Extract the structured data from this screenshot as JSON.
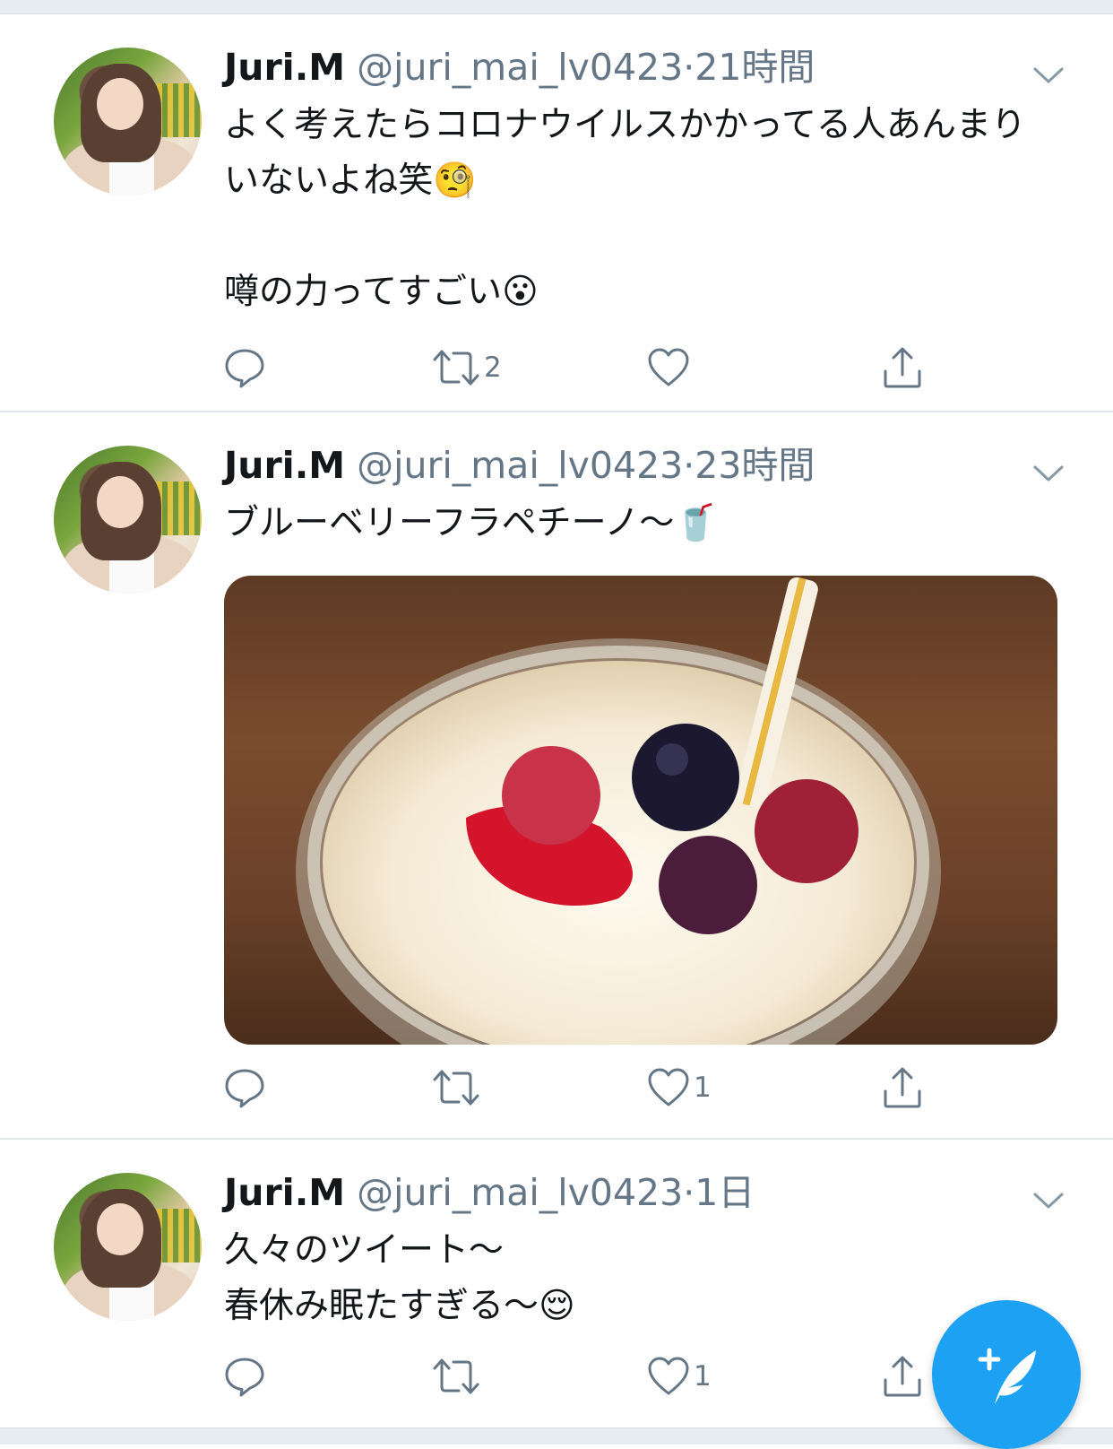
{
  "tweets": [
    {
      "name": "Juri.M",
      "handle": "@juri_mai_lv0423",
      "separator": "·",
      "time": "21時間",
      "text": "よく考えたらコロナウイルスかかってる人あんまりいないよね笑🧐\n\n噂の力ってすごい😮",
      "reply_count": "",
      "retweet_count": "2",
      "like_count": ""
    },
    {
      "name": "Juri.M",
      "handle": "@juri_mai_lv0423",
      "separator": "·",
      "time": "23時間",
      "text": "ブルーベリーフラペチーノ〜🥤",
      "reply_count": "",
      "retweet_count": "",
      "like_count": "1"
    },
    {
      "name": "Juri.M",
      "handle": "@juri_mai_lv0423",
      "separator": "·",
      "time": "1日",
      "text": "久々のツイート〜\n春休み眠たすぎる〜😌",
      "reply_count": "",
      "retweet_count": "",
      "like_count": "1"
    }
  ],
  "icons": {
    "reply": "reply-icon",
    "retweet": "retweet-icon",
    "like": "heart-icon",
    "share": "share-icon",
    "menu": "chevron-down-icon",
    "compose": "compose-tweet-icon"
  },
  "colors": {
    "accent": "#1da1f2",
    "secondary_text": "#657786",
    "divider": "#e1e8ed"
  }
}
